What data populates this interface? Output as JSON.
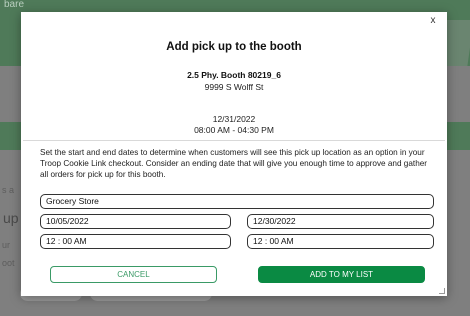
{
  "background": {
    "header_text": "bare",
    "fragments": [
      "s a",
      "up",
      "ur",
      "oot"
    ]
  },
  "modal": {
    "close_label": "x",
    "title": "Add pick up to the booth",
    "booth_name": "2.5 Phy. Booth 80219_6",
    "address": "9999 S Wolff St",
    "date": "12/31/2022",
    "time_range": "08:00 AM - 04:30 PM",
    "description": "Set the start and end dates to determine when customers will see this pick up location as an option in your Troop Cookie Link checkout. Consider an ending date that will give you enough time to approve and gather all orders for pick up for this booth.",
    "fields": {
      "location_name": "Grocery Store",
      "start_date": "10/05/2022",
      "end_date": "12/30/2022",
      "start_time": "12 : 00  AM",
      "end_time": "12 : 00  AM"
    },
    "buttons": {
      "cancel": "CANCEL",
      "add": "ADD TO MY LIST"
    }
  },
  "colors": {
    "accent_green": "#0a8a43",
    "cancel_green": "#3a9a66",
    "header_green": "#4f7a59"
  }
}
